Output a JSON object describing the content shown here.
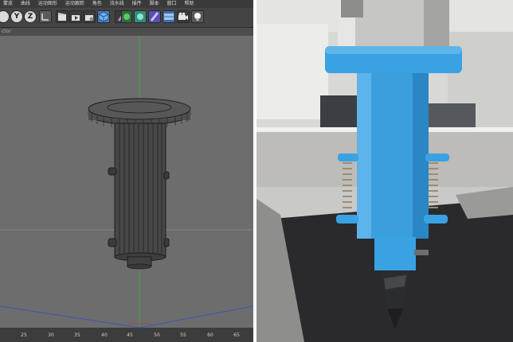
{
  "menu": {
    "items": [
      "蒙皮",
      "曲线",
      "运动图形",
      "运动跟踪",
      "角色",
      "流水线",
      "插件",
      "脚本",
      "窗口",
      "帮助"
    ]
  },
  "toolbar": {
    "y_axis": "Y",
    "z_axis": "Z"
  },
  "viewport": {
    "label": "ctor"
  },
  "ruler": {
    "ticks": [
      "25",
      "30",
      "35",
      "40",
      "45",
      "50",
      "55",
      "60",
      "65"
    ]
  },
  "colors": {
    "model_gray": "#454545",
    "wire_dark": "#1e1e1e",
    "grid_green": "#3ea53e",
    "grid_blue": "#3a55b8",
    "grid_red": "#b04040",
    "print_blue": "#3aa2e2",
    "mat_dark": "#2a2a2c"
  },
  "photo": {
    "alt_subject": "3d-printed-pen-holder-on-plotter"
  }
}
